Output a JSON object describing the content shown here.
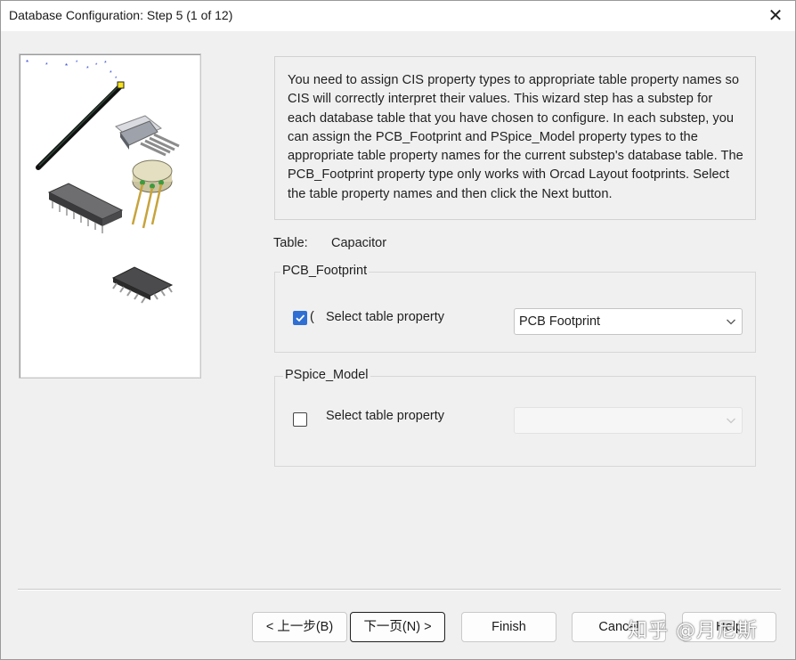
{
  "window": {
    "title": "Database Configuration: Step 5 (1 of 12)",
    "close_glyph": "✕"
  },
  "description": "You need to assign CIS property types to appropriate table property names so CIS will correctly interpret their values. This wizard step has a substep for each database table that you have chosen to configure. In each substep, you can assign the PCB_Footprint and PSpice_Model property types to the appropriate table property names for the current substep's database table. The PCB_Footprint property type only works with Orcad Layout footprints. Select the table property names and then click the Next button.",
  "table": {
    "label": "Table:",
    "value": "Capacitor"
  },
  "groups": [
    {
      "legend": "PCB_Footprint",
      "checkbox_label": "Select table property",
      "checked": true,
      "selected_value": "PCB Footprint",
      "enabled": true
    },
    {
      "legend": "PSpice_Model",
      "checkbox_label": "Select table property",
      "checked": false,
      "selected_value": "",
      "enabled": false
    }
  ],
  "buttons": {
    "back": "< 上一步(B)",
    "next": "下一页(N) >",
    "finish": "Finish",
    "cancel": "Cancel",
    "help": "Help"
  },
  "watermark": "知乎 @月尼斯",
  "icons": {
    "close": "close-icon",
    "chevron": "chevron-down-icon",
    "check": "check-icon"
  },
  "colors": {
    "checkbox_accent": "#2f6fd3",
    "window_bg": "#f0f0f0"
  }
}
